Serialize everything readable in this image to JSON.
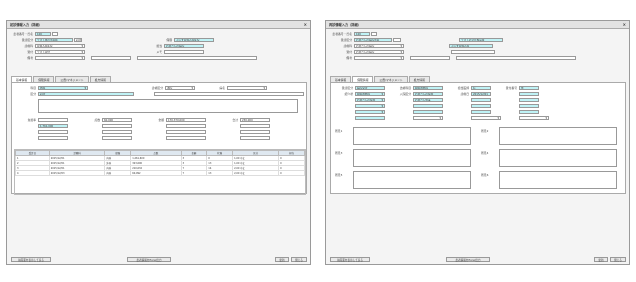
{
  "left": {
    "title": "初診情報入力（詳細）",
    "close": "×",
    "fields": {
      "kanja_label": "患者番号・氏名",
      "kanja_no": "100",
      "kanja_name": "テスト用の患者様",
      "kubun_label": "受診区分",
      "kubun_value": "初診",
      "hoken_label": "保険",
      "hoken_value": "ぷらす産婦人科医院",
      "shinryo_label": "診療科",
      "shinryo_value": "産婦人科医院",
      "tanto_label": "担当",
      "tanto_value": "お母さんの病院",
      "uketsuke_label": "受付",
      "uketsuke_value": "テスト受付",
      "memo_label": "メモ",
      "memo_value": "",
      "biko_label": "備考",
      "biko_value": ""
    },
    "tabs": [
      "基本情報",
      "保険情報",
      "公費/マネジメント",
      "処方情報"
    ],
    "summary": {
      "r1": [
        "科目",
        "診療区分",
        "病名",
        "区分"
      ],
      "r1v": [
        "内科",
        "通院",
        "",
        "初診"
      ],
      "amounts_label": [
        "負担率",
        "点数",
        "金額",
        "合計"
      ],
      "amounts": [
        "1,761,000",
        "60,000",
        "170,370,000",
        "230,000"
      ]
    },
    "list_header": [
      "受診日",
      "診療科",
      "保険",
      "点数",
      "金額",
      "状態",
      "区分",
      "担当"
    ],
    "list_rows": [
      [
        "1",
        "2015/12/01",
        "内科",
        "1,261,600",
        "3",
        "0",
        "1,00 中止",
        "0"
      ],
      [
        "2",
        "2015/12/01",
        "外科",
        "323,600",
        "3",
        "13",
        "1,00 中止",
        "0"
      ],
      [
        "3",
        "2015/12/01",
        "内科",
        "210,632",
        "7",
        "14",
        "2,00 中止",
        "0"
      ],
      [
        "4",
        "2015/12/03",
        "内科",
        "60,992",
        "7",
        "13",
        "2,00 中止",
        "0"
      ]
    ],
    "buttons": {
      "left": "前画面を表示して戻る",
      "center": "患者情報をExcel出力",
      "right1": "更新",
      "right2": "閉じる"
    }
  },
  "right": {
    "title": "再診情報入力（詳細）",
    "close": "×",
    "fields": {
      "kanja_no": "100",
      "kanja_name": "お母さんの病院患者",
      "extra1": "テストの公共施設様",
      "extra2": "ぷらす産婦人科",
      "hoken_value": "お母さんの病院",
      "tanto_value": "お母さんの病院"
    },
    "tabs": [
      "基本情報",
      "保険情報",
      "公費/マネジメント",
      "処方情報"
    ],
    "form_labels": [
      "受診区分",
      "治療科目",
      "担当医師",
      "受付番号",
      "紹介状",
      "入院区分",
      "診療日"
    ],
    "form_values": [
      "病院受診",
      "呼吸器内科",
      "お母さんの医師",
      "お母さん外来",
      "有",
      "無",
      "2015/12/01"
    ],
    "memo_labels": [
      "所見1",
      "所見2",
      "所見3",
      "所見4",
      "所見5",
      "所見6"
    ],
    "buttons": {
      "left": "前画面を表示して戻る",
      "center": "患者情報をExcel出力",
      "right1": "更新",
      "right2": "閉じる"
    }
  }
}
